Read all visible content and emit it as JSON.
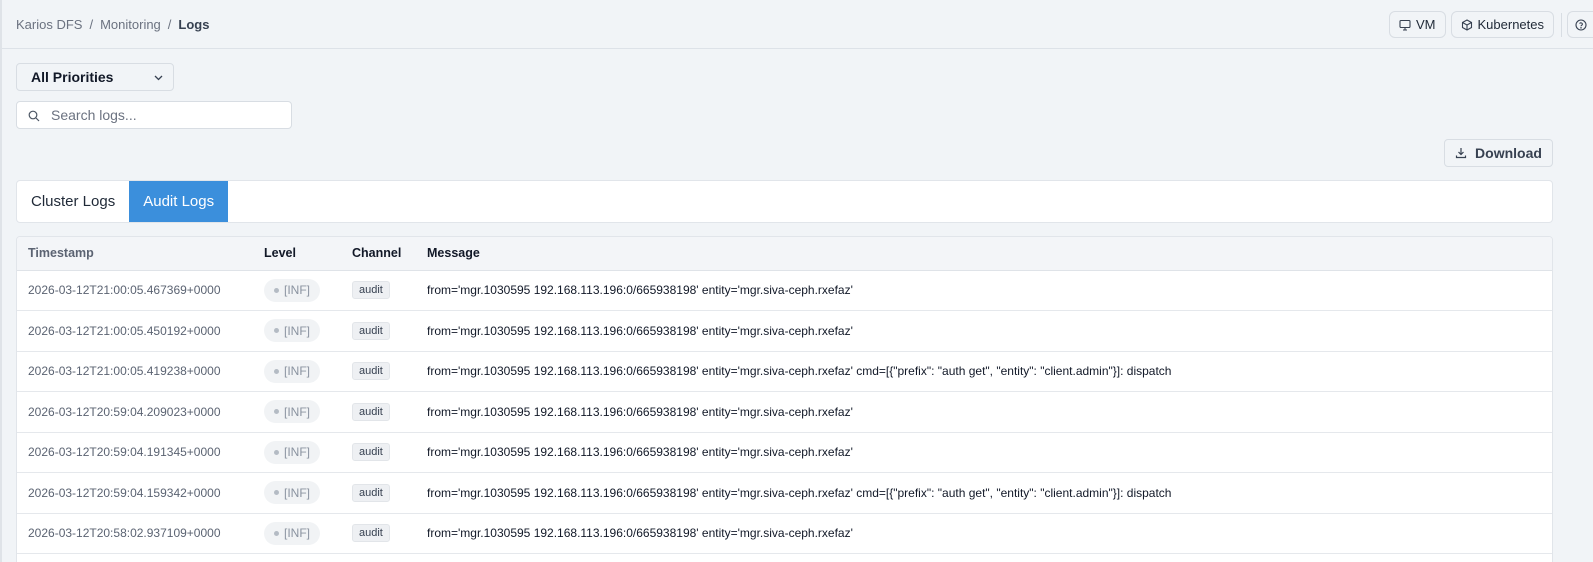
{
  "breadcrumb": {
    "root": "Karios DFS",
    "section": "Monitoring",
    "current": "Logs",
    "separator": "/"
  },
  "top_actions": {
    "vm_label": "VM",
    "kubernetes_label": "Kubernetes"
  },
  "filter": {
    "priority_selected": "All Priorities"
  },
  "search": {
    "placeholder": "Search logs..."
  },
  "download_label": "Download",
  "tabs": [
    {
      "label": "Cluster Logs",
      "active": false
    },
    {
      "label": "Audit Logs",
      "active": true
    }
  ],
  "table": {
    "headers": {
      "timestamp": "Timestamp",
      "level": "Level",
      "channel": "Channel",
      "message": "Message"
    },
    "rows": [
      {
        "timestamp": "2026-03-12T21:00:05.467369+0000",
        "level": "[INF]",
        "channel": "audit",
        "message": "from='mgr.1030595 192.168.113.196:0/665938198' entity='mgr.siva-ceph.rxefaz'"
      },
      {
        "timestamp": "2026-03-12T21:00:05.450192+0000",
        "level": "[INF]",
        "channel": "audit",
        "message": "from='mgr.1030595 192.168.113.196:0/665938198' entity='mgr.siva-ceph.rxefaz'"
      },
      {
        "timestamp": "2026-03-12T21:00:05.419238+0000",
        "level": "[INF]",
        "channel": "audit",
        "message": "from='mgr.1030595 192.168.113.196:0/665938198' entity='mgr.siva-ceph.rxefaz' cmd=[{\"prefix\": \"auth get\", \"entity\": \"client.admin\"}]: dispatch"
      },
      {
        "timestamp": "2026-03-12T20:59:04.209023+0000",
        "level": "[INF]",
        "channel": "audit",
        "message": "from='mgr.1030595 192.168.113.196:0/665938198' entity='mgr.siva-ceph.rxefaz'"
      },
      {
        "timestamp": "2026-03-12T20:59:04.191345+0000",
        "level": "[INF]",
        "channel": "audit",
        "message": "from='mgr.1030595 192.168.113.196:0/665938198' entity='mgr.siva-ceph.rxefaz'"
      },
      {
        "timestamp": "2026-03-12T20:59:04.159342+0000",
        "level": "[INF]",
        "channel": "audit",
        "message": "from='mgr.1030595 192.168.113.196:0/665938198' entity='mgr.siva-ceph.rxefaz' cmd=[{\"prefix\": \"auth get\", \"entity\": \"client.admin\"}]: dispatch"
      },
      {
        "timestamp": "2026-03-12T20:58:02.937109+0000",
        "level": "[INF]",
        "channel": "audit",
        "message": "from='mgr.1030595 192.168.113.196:0/665938198' entity='mgr.siva-ceph.rxefaz'"
      }
    ]
  },
  "colors": {
    "accent": "#3b8fdc",
    "background": "#f1f4f7"
  },
  "icons": {
    "vm": "monitor-icon",
    "kubernetes": "cube-icon",
    "help": "help-circle-icon",
    "search": "search-icon",
    "download": "download-icon",
    "select": "chevron-down-icon"
  }
}
